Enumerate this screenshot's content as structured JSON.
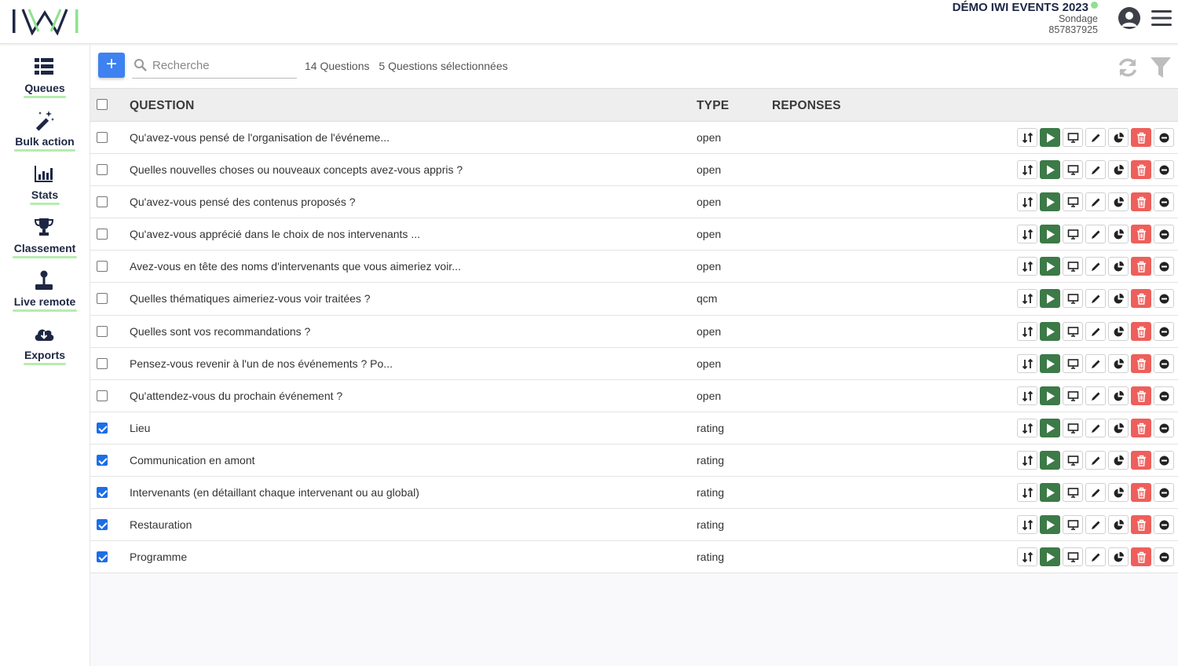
{
  "header": {
    "logo_text": "IWI",
    "event_title": "DÉMO IWI EVENTS 2023",
    "event_type": "Sondage",
    "event_code": "857837925",
    "status_color": "#8fe18f"
  },
  "sidebar": {
    "items": [
      {
        "label": "Queues",
        "icon": "list-icon"
      },
      {
        "label": "Bulk action",
        "icon": "magic-wand-icon"
      },
      {
        "label": "Stats",
        "icon": "bar-chart-icon"
      },
      {
        "label": "Classement",
        "icon": "trophy-icon"
      },
      {
        "label": "Live remote",
        "icon": "joystick-icon"
      },
      {
        "label": "Exports",
        "icon": "cloud-download-icon"
      }
    ]
  },
  "toolbar": {
    "add_label": "+",
    "search_placeholder": "Recherche",
    "questions_count": "14 Questions",
    "selected_count": "5 Questions sélectionnées"
  },
  "table": {
    "headers": {
      "question": "QUESTION",
      "type": "TYPE",
      "responses": "REPONSES"
    },
    "rows": [
      {
        "question": "Qu'avez-vous pensé de l'organisation de l'événeme...",
        "type": "open",
        "checked": false
      },
      {
        "question": "Quelles nouvelles choses ou nouveaux concepts avez-vous appris ?",
        "type": "open",
        "checked": false
      },
      {
        "question": "Qu'avez-vous pensé des contenus proposés ?",
        "type": "open",
        "checked": false
      },
      {
        "question": "Qu'avez-vous apprécié dans le choix de nos intervenants ...",
        "type": "open",
        "checked": false
      },
      {
        "question": "Avez-vous en tête des noms d'intervenants que vous aimeriez voir...",
        "type": "open",
        "checked": false
      },
      {
        "question": "Quelles thématiques aimeriez-vous voir traitées ?",
        "type": "qcm",
        "checked": false
      },
      {
        "question": "Quelles sont vos recommandations ?",
        "type": "open",
        "checked": false
      },
      {
        "question": "Pensez-vous revenir à l'un de nos événements ? Po...",
        "type": "open",
        "checked": false
      },
      {
        "question": "Qu'attendez-vous du prochain événement ?",
        "type": "open",
        "checked": false
      },
      {
        "question": "Lieu",
        "type": "rating",
        "checked": true
      },
      {
        "question": "Communication en amont",
        "type": "rating",
        "checked": true
      },
      {
        "question": "Intervenants (en détaillant chaque intervenant ou au global)",
        "type": "rating",
        "checked": true
      },
      {
        "question": "Restauration",
        "type": "rating",
        "checked": true
      },
      {
        "question": "Programme",
        "type": "rating",
        "checked": true
      }
    ],
    "row_actions": [
      "sort-icon",
      "play-icon",
      "monitor-icon",
      "pencil-icon",
      "pie-chart-icon",
      "trash-icon",
      "minus-circle-icon"
    ]
  },
  "colors": {
    "brand_dark": "#1d2744",
    "brand_green": "#8fe18f",
    "primary_blue": "#3d82f0",
    "play_green": "#3c7a47",
    "delete_red": "#ee5f5b"
  }
}
